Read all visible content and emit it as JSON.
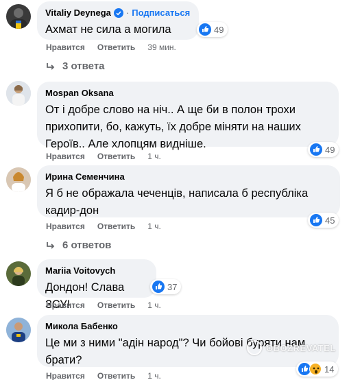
{
  "comments": [
    {
      "author": "Vitaliy Deynega",
      "subscribe_label": "Подписаться",
      "separator": "·",
      "text": "Ахмат не сила а могила",
      "reaction_count": "49",
      "like_label": "Нравится",
      "reply_label": "Ответить",
      "time": "39 мин."
    },
    {
      "author": "Mospan Oksana",
      "text_lines": [
        "От і добре слово на ніч.. А ще би в полон трохи",
        "прихопити, бо, кажуть, їх добре міняти на наших",
        "Героїв.. Але хлопцям видніше."
      ],
      "reaction_count": "49",
      "like_label": "Нравится",
      "reply_label": "Ответить",
      "time": "1 ч."
    },
    {
      "author": "Ирина Семенчина",
      "text_lines": [
        "Я б не ображала чеченців, написала б республіка",
        "кадир-дон"
      ],
      "reaction_count": "45",
      "like_label": "Нравится",
      "reply_label": "Ответить",
      "time": "1 ч."
    },
    {
      "author": "Mariia Voitovych",
      "text": "Дондон! Слава ЗСУ!",
      "reaction_count": "37",
      "like_label": "Нравится",
      "reply_label": "Ответить",
      "time": "1 ч."
    },
    {
      "author": "Микола Бабенко",
      "text_lines": [
        "Це ми з ними \"адін народ\"? Чи бойові буряти нам",
        "брати?"
      ],
      "reaction_count": "14",
      "like_label": "Нравится",
      "reply_label": "Ответить",
      "time": "1 ч."
    }
  ],
  "replies": [
    {
      "label": "3 ответа"
    },
    {
      "label": "6 ответов"
    }
  ],
  "watermark": "OBOZREVATEL",
  "colors": {
    "accent": "#1877f2",
    "bubble": "#f0f2f5",
    "secondary_text": "#65676b",
    "wow": "#f7b125"
  },
  "icons": [
    "verified-badge-icon",
    "like-reaction-icon",
    "wow-reaction-icon",
    "reply-arrow-icon"
  ]
}
